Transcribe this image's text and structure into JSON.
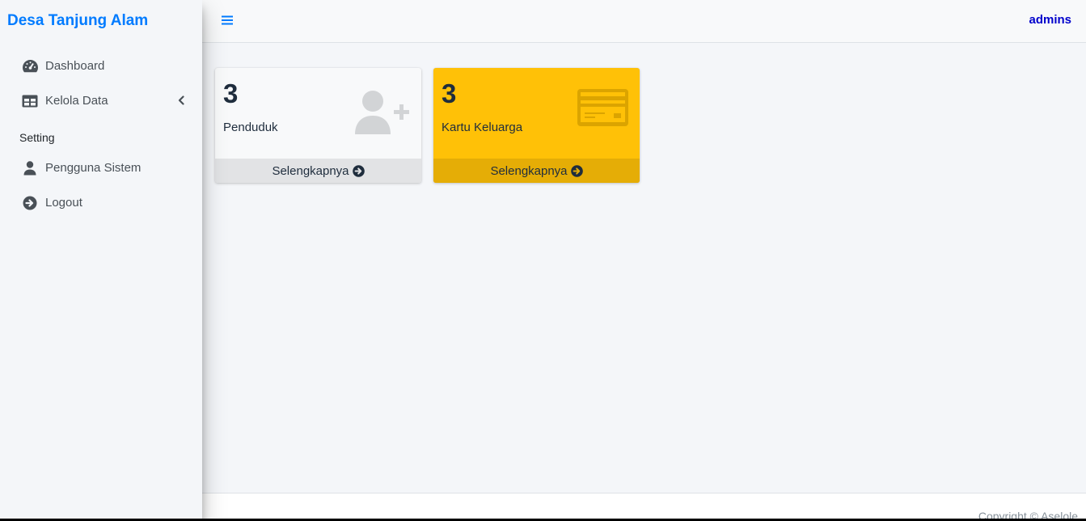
{
  "brand": {
    "title": "Desa Tanjung Alam",
    "color": "#007bff"
  },
  "sidebar": {
    "items": [
      {
        "label": "Dashboard",
        "icon": "tachometer-icon"
      },
      {
        "label": "Kelola Data",
        "icon": "table-icon",
        "has_submenu": true
      }
    ],
    "header": "Setting",
    "settings_items": [
      {
        "label": "Pengguna Sistem",
        "icon": "user-icon"
      },
      {
        "label": "Logout",
        "icon": "arrow-circle-right-icon"
      }
    ]
  },
  "topbar": {
    "menu_icon": "bars-icon",
    "user": "admins"
  },
  "cards": [
    {
      "count": "3",
      "label": "Penduduk",
      "link": "Selengkapnya",
      "icon": "user-plus-icon",
      "color": "#f8f9fa"
    },
    {
      "count": "3",
      "label": "Kartu Keluarga",
      "link": "Selengkapnya",
      "icon": "credit-card-icon",
      "color": "#ffc107"
    }
  ],
  "footer": {
    "copyright": "Copyright © Aselole"
  }
}
